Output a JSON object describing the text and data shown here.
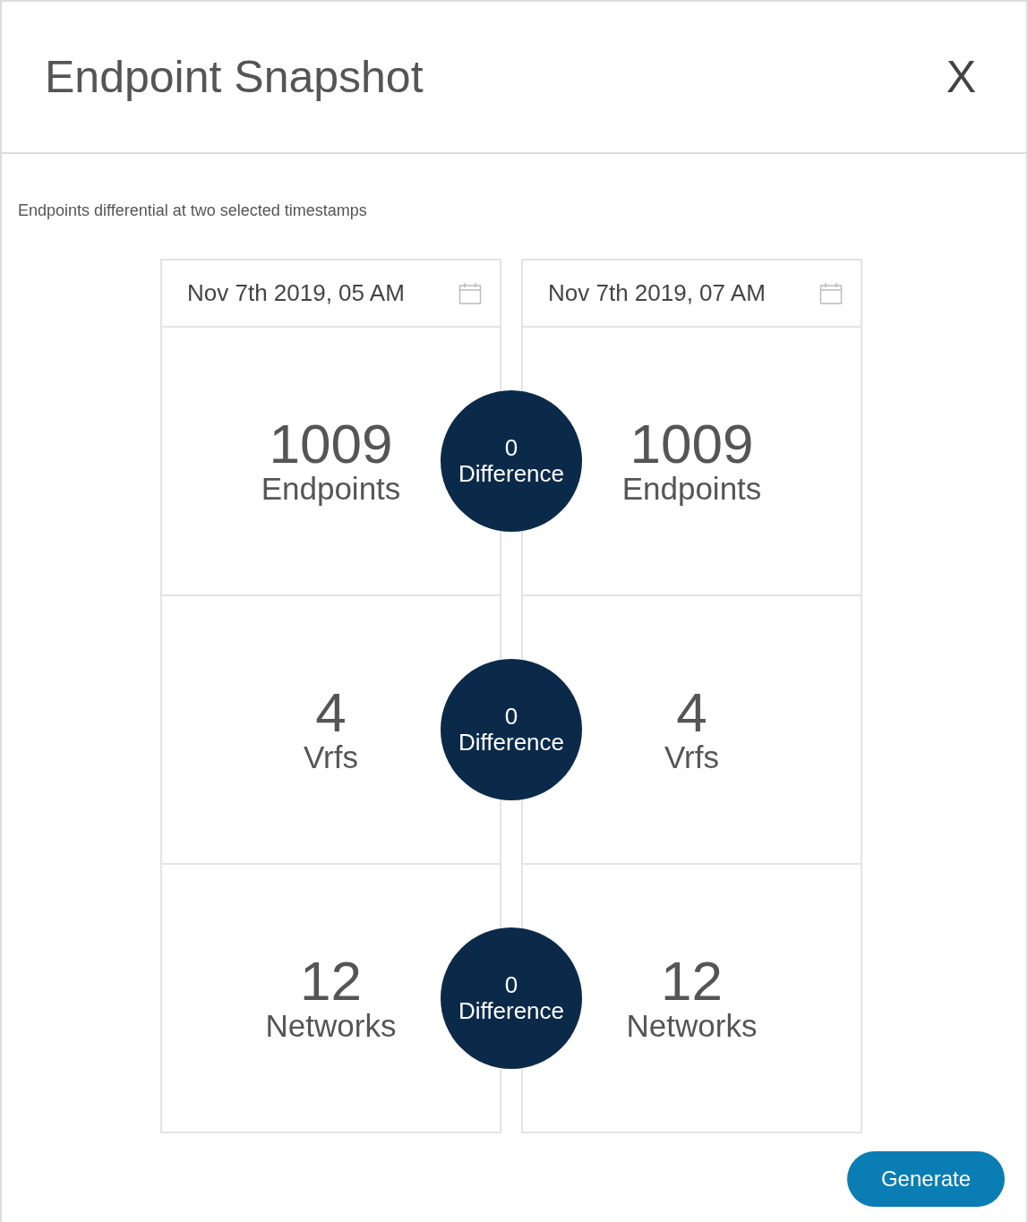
{
  "dialog": {
    "title": "Endpoint Snapshot",
    "close_label": "X"
  },
  "description": "Endpoints differential at two selected timestamps",
  "timestamps": [
    {
      "value": "Nov 7th 2019, 05 AM"
    },
    {
      "value": "Nov 7th 2019, 07 AM"
    }
  ],
  "metrics": [
    {
      "left_value": "1009",
      "left_label": "Endpoints",
      "difference_value": "0",
      "difference_label": "Difference",
      "right_value": "1009",
      "right_label": "Endpoints"
    },
    {
      "left_value": "4",
      "left_label": "Vrfs",
      "difference_value": "0",
      "difference_label": "Difference",
      "right_value": "4",
      "right_label": "Vrfs"
    },
    {
      "left_value": "12",
      "left_label": "Networks",
      "difference_value": "0",
      "difference_label": "Difference",
      "right_value": "12",
      "right_label": "Networks"
    }
  ],
  "buttons": [
    {
      "label": "Generate"
    }
  ]
}
